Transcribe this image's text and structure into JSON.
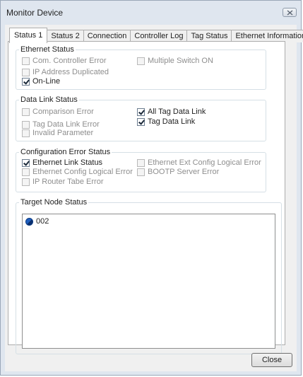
{
  "window": {
    "title": "Monitor Device"
  },
  "tabs": [
    "Status 1",
    "Status 2",
    "Connection",
    "Controller Log",
    "Tag Status",
    "Ethernet Information"
  ],
  "ethernet_status": {
    "label": "Ethernet Status",
    "items": [
      {
        "label": "Com. Controller Error",
        "checked": false,
        "enabled": false
      },
      {
        "label": "IP Address Duplicated",
        "checked": false,
        "enabled": false
      },
      {
        "label": "On-Line",
        "checked": true,
        "enabled": true
      },
      {
        "label": "Multiple Switch ON",
        "checked": false,
        "enabled": false
      }
    ]
  },
  "data_link_status": {
    "label": "Data Link Status",
    "items": [
      {
        "label": "Comparison Error",
        "checked": false,
        "enabled": false
      },
      {
        "label": "Tag Data Link Error",
        "checked": false,
        "enabled": false
      },
      {
        "label": "Invalid Parameter",
        "checked": false,
        "enabled": false
      },
      {
        "label": "All Tag Data Link",
        "checked": true,
        "enabled": true
      },
      {
        "label": "Tag Data Link",
        "checked": true,
        "enabled": true
      }
    ]
  },
  "config_error_status": {
    "label": "Configuration Error Status",
    "items": [
      {
        "label": "Ethernet Link Status",
        "checked": true,
        "enabled": true
      },
      {
        "label": "Ethernet Config Logical Error",
        "checked": false,
        "enabled": false
      },
      {
        "label": "IP Router Tabe Error",
        "checked": false,
        "enabled": false
      },
      {
        "label": "Ethernet Ext Config Logical Error",
        "checked": false,
        "enabled": false
      },
      {
        "label": "BOOTP Server Error",
        "checked": false,
        "enabled": false
      }
    ]
  },
  "target_node_status": {
    "label": "Target Node Status",
    "nodes": [
      {
        "label": "002",
        "icon": "node-status-icon"
      }
    ]
  },
  "buttons": {
    "close": "Close"
  }
}
